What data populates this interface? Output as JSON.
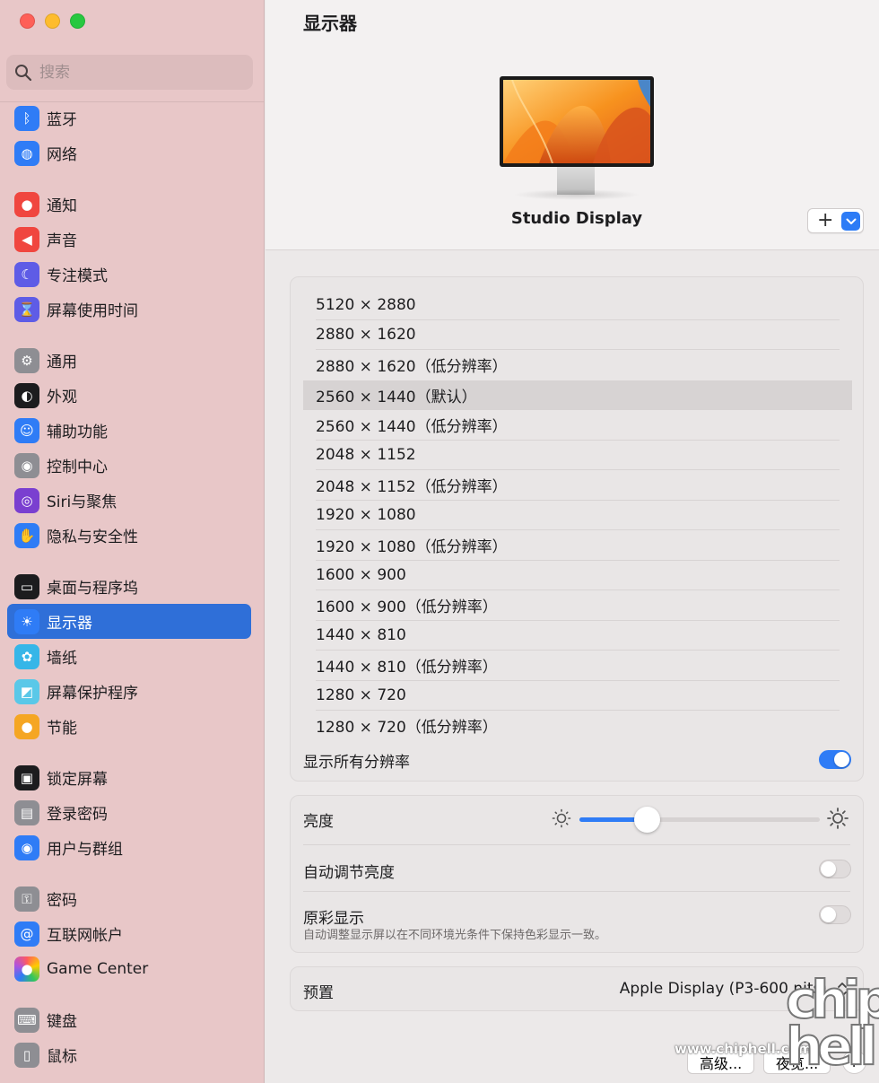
{
  "window": {
    "title": "显示器"
  },
  "search": {
    "placeholder": "搜索"
  },
  "sidebar": {
    "groups": [
      [
        {
          "label": "蓝牙",
          "icon": "bluetooth-icon",
          "color": "#2f7cf6"
        },
        {
          "label": "网络",
          "icon": "globe-icon",
          "color": "#2f7cf6"
        }
      ],
      [
        {
          "label": "通知",
          "icon": "bell-icon",
          "color": "#f0463f"
        },
        {
          "label": "声音",
          "icon": "speaker-icon",
          "color": "#f0463f"
        },
        {
          "label": "专注模式",
          "icon": "moon-icon",
          "color": "#5e5ce6"
        },
        {
          "label": "屏幕使用时间",
          "icon": "hourglass-icon",
          "color": "#5e5ce6"
        }
      ],
      [
        {
          "label": "通用",
          "icon": "gear-icon",
          "color": "#8e8e93"
        },
        {
          "label": "外观",
          "icon": "appearance-icon",
          "color": "#1c1c1e"
        },
        {
          "label": "辅助功能",
          "icon": "accessibility-icon",
          "color": "#2f7cf6"
        },
        {
          "label": "控制中心",
          "icon": "switches-icon",
          "color": "#8e8e93"
        },
        {
          "label": "Siri与聚焦",
          "icon": "siri-icon",
          "color": "#7a3fd0"
        },
        {
          "label": "隐私与安全性",
          "icon": "hand-icon",
          "color": "#2f7cf6"
        }
      ],
      [
        {
          "label": "桌面与程序坞",
          "icon": "dock-icon",
          "color": "#1c1c1e"
        },
        {
          "label": "显示器",
          "icon": "sun-icon",
          "color": "#2f7cf6",
          "active": true
        },
        {
          "label": "墙纸",
          "icon": "flower-icon",
          "color": "#36b6e8"
        },
        {
          "label": "屏幕保护程序",
          "icon": "screensaver-icon",
          "color": "#5ac8e8"
        },
        {
          "label": "节能",
          "icon": "bulb-icon",
          "color": "#f5a623"
        }
      ],
      [
        {
          "label": "锁定屏幕",
          "icon": "lock-screen-icon",
          "color": "#1c1c1e"
        },
        {
          "label": "登录密码",
          "icon": "lock-icon",
          "color": "#8e8e93"
        },
        {
          "label": "用户与群组",
          "icon": "users-icon",
          "color": "#2f7cf6"
        }
      ],
      [
        {
          "label": "密码",
          "icon": "key-icon",
          "color": "#8e8e93"
        },
        {
          "label": "互联网帐户",
          "icon": "at-icon",
          "color": "#2f7cf6"
        },
        {
          "label": "Game Center",
          "icon": "game-center-icon",
          "color": "#ffffff"
        }
      ],
      [
        {
          "label": "键盘",
          "icon": "keyboard-icon",
          "color": "#8e8e93"
        },
        {
          "label": "鼠标",
          "icon": "mouse-icon",
          "color": "#8e8e93"
        }
      ]
    ]
  },
  "display": {
    "name": "Studio Display",
    "add_symbol": "+"
  },
  "resolutions": {
    "selected_index": 3,
    "items": [
      "5120 × 2880",
      "2880 × 1620",
      "2880 × 1620（低分辨率）",
      "2560 × 1440（默认）",
      "2560 × 1440（低分辨率）",
      "2048 × 1152",
      "2048 × 1152（低分辨率）",
      "1920 × 1080",
      "1920 × 1080（低分辨率）",
      "1600 × 900",
      "1600 × 900（低分辨率）",
      "1440 × 810",
      "1440 × 810（低分辨率）",
      "1280 × 720",
      "1280 × 720（低分辨率）"
    ],
    "show_all_label": "显示所有分辨率",
    "show_all_on": true
  },
  "brightness": {
    "label": "亮度",
    "level_percent": 28,
    "auto_label": "自动调节亮度",
    "auto_on": false,
    "true_tone_label": "原彩显示",
    "true_tone_on": false,
    "true_tone_hint": "自动调整显示屏以在不同环境光条件下保持色彩显示一致。"
  },
  "preset": {
    "label": "预置",
    "value": "Apple Display (P3-600 nits)"
  },
  "buttons": {
    "advanced": "高级...",
    "night_shift": "夜览...",
    "help": "?"
  },
  "watermark": {
    "url": "www.chiphell.com",
    "logo": "chip hell"
  },
  "colors": {
    "accent": "#2f7cf6",
    "sidebar_bg": "#e8c7c8",
    "selected_sidebar": "#2f6fd8"
  }
}
